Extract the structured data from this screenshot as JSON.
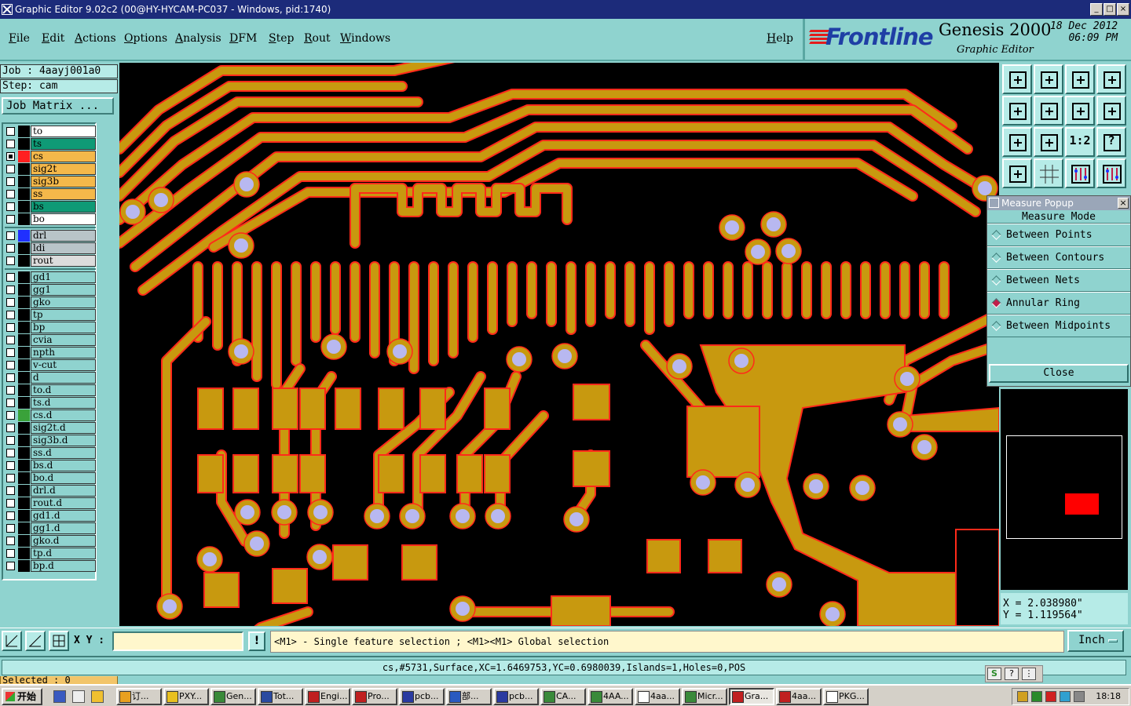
{
  "window": {
    "title": "Graphic Editor 9.02c2 (00@HY-HYCAM-PC037 - Windows, pid:1740)",
    "controls": [
      "_",
      "□",
      "×"
    ]
  },
  "menu": [
    "File",
    "Edit",
    "Actions",
    "Options",
    "Analysis",
    "DFM",
    "Step",
    "Rout",
    "Windows"
  ],
  "help_label": "Help",
  "brand": {
    "logo": "Frontline",
    "product": "Genesis 2000",
    "subtitle": "Graphic Editor",
    "date": "18 Dec 2012",
    "time": "06:09 PM"
  },
  "job": {
    "job_line": "Job : 4aayj001a0",
    "step_line": "Step: cam",
    "matrix_button": "Job Matrix ..."
  },
  "layers": [
    {
      "name": "to",
      "color": "#ffffff",
      "checked": false,
      "swatch": "#000000"
    },
    {
      "name": "ts",
      "color": "#0f9a76",
      "checked": false,
      "swatch": "#000000"
    },
    {
      "name": "cs",
      "color": "#f4b84a",
      "checked": true,
      "swatch": "#ff2020",
      "marker": true
    },
    {
      "name": "sig2t",
      "color": "#f4b84a",
      "checked": false,
      "swatch": "#000000"
    },
    {
      "name": "sig3b",
      "color": "#f4b84a",
      "checked": false,
      "swatch": "#000000"
    },
    {
      "name": "ss",
      "color": "#f4b84a",
      "checked": false,
      "swatch": "#000000"
    },
    {
      "name": "bs",
      "color": "#0f9a76",
      "checked": false,
      "swatch": "#000000"
    },
    {
      "name": "bo",
      "color": "#ffffff",
      "checked": false,
      "swatch": "#000000"
    },
    {
      "name": "drl",
      "color": "#b8c4c8",
      "checked": false,
      "swatch": "#2030ff"
    },
    {
      "name": "ldi",
      "color": "#b8c4c8",
      "checked": false,
      "swatch": "#000000"
    },
    {
      "name": "rout",
      "color": "#dcdcdc",
      "checked": false,
      "swatch": "#000000"
    },
    {
      "name": "gd1",
      "color": "#8fd3cf",
      "checked": false,
      "swatch": "#000000"
    },
    {
      "name": "gg1",
      "color": "#8fd3cf",
      "checked": false,
      "swatch": "#000000"
    },
    {
      "name": "gko",
      "color": "#8fd3cf",
      "checked": false,
      "swatch": "#000000"
    },
    {
      "name": "tp",
      "color": "#8fd3cf",
      "checked": false,
      "swatch": "#000000"
    },
    {
      "name": "bp",
      "color": "#8fd3cf",
      "checked": false,
      "swatch": "#000000"
    },
    {
      "name": "cvia",
      "color": "#8fd3cf",
      "checked": false,
      "swatch": "#000000"
    },
    {
      "name": "npth",
      "color": "#8fd3cf",
      "checked": false,
      "swatch": "#000000"
    },
    {
      "name": "v-cut",
      "color": "#8fd3cf",
      "checked": false,
      "swatch": "#000000"
    },
    {
      "name": "d",
      "color": "#8fd3cf",
      "checked": false,
      "swatch": "#000000"
    },
    {
      "name": "to.d",
      "color": "#8fd3cf",
      "checked": false,
      "swatch": "#000000"
    },
    {
      "name": "ts.d",
      "color": "#8fd3cf",
      "checked": false,
      "swatch": "#000000"
    },
    {
      "name": "cs.d",
      "color": "#8fd3cf",
      "checked": false,
      "swatch": "#3aa23a"
    },
    {
      "name": "sig2t.d",
      "color": "#8fd3cf",
      "checked": false,
      "swatch": "#000000"
    },
    {
      "name": "sig3b.d",
      "color": "#8fd3cf",
      "checked": false,
      "swatch": "#000000"
    },
    {
      "name": "ss.d",
      "color": "#8fd3cf",
      "checked": false,
      "swatch": "#000000"
    },
    {
      "name": "bs.d",
      "color": "#8fd3cf",
      "checked": false,
      "swatch": "#000000"
    },
    {
      "name": "bo.d",
      "color": "#8fd3cf",
      "checked": false,
      "swatch": "#000000"
    },
    {
      "name": "drl.d",
      "color": "#8fd3cf",
      "checked": false,
      "swatch": "#000000"
    },
    {
      "name": "rout.d",
      "color": "#8fd3cf",
      "checked": false,
      "swatch": "#000000"
    },
    {
      "name": "gd1.d",
      "color": "#8fd3cf",
      "checked": false,
      "swatch": "#000000"
    },
    {
      "name": "gg1.d",
      "color": "#8fd3cf",
      "checked": false,
      "swatch": "#000000"
    },
    {
      "name": "gko.d",
      "color": "#8fd3cf",
      "checked": false,
      "swatch": "#000000"
    },
    {
      "name": "tp.d",
      "color": "#8fd3cf",
      "checked": false,
      "swatch": "#000000"
    },
    {
      "name": "bp.d",
      "color": "#8fd3cf",
      "checked": false,
      "swatch": "#000000"
    }
  ],
  "selected": "Selected : 0",
  "tools": [
    "zoom-home-icon",
    "zoom-layer-icon",
    "zoom-home-icon",
    "zoom-window-icon",
    "pan-left-icon",
    "pan-right-icon",
    "redraw-icon",
    "snap-icon",
    "fit-icon",
    "pan-all-icon",
    "scale-1-2-icon",
    "help-query-icon",
    "measure-tool-icon",
    "grid-icon",
    "ruler-red-icon",
    "ruler-red2-icon"
  ],
  "tool_labels": {
    "ratio": "1:2",
    "query": "?"
  },
  "measure": {
    "title": "Measure Popup",
    "mode_label": "Measure Mode",
    "options": [
      {
        "label": "Between Points",
        "selected": false
      },
      {
        "label": "Between Contours",
        "selected": false
      },
      {
        "label": "Between Nets",
        "selected": false
      },
      {
        "label": "Annular Ring",
        "selected": true
      },
      {
        "label": "Between Midpoints",
        "selected": false
      }
    ],
    "close_label": "Close"
  },
  "coords": {
    "x": "X = 2.038980\"",
    "y": "Y = 1.119564\""
  },
  "command": {
    "xy_label": "X Y :",
    "xy_value": "",
    "hint": "<M1> - Single feature selection ; <M1><M1> Global selection",
    "unit": "Inch"
  },
  "status": "cs,#5731,Surface,XC=1.6469753,YC=0.6980039,Islands=1,Holes=0,POS",
  "taskbar": {
    "start": "开始",
    "tasks": [
      {
        "label": "订...",
        "color": "#e8a020"
      },
      {
        "label": "PXY...",
        "color": "#e8c020"
      },
      {
        "label": "Gen...",
        "color": "#3a8a3a"
      },
      {
        "label": "Tot...",
        "color": "#2a4aa0"
      },
      {
        "label": "Engi...",
        "color": "#c02020"
      },
      {
        "label": "Pro...",
        "color": "#c02020"
      },
      {
        "label": "pcb...",
        "color": "#2a3aa0"
      },
      {
        "label": "部...",
        "color": "#2a5ac0"
      },
      {
        "label": "pcb...",
        "color": "#2a3aa0"
      },
      {
        "label": "CA...",
        "color": "#3a8a3a"
      },
      {
        "label": "4AA...",
        "color": "#3a8a3a"
      },
      {
        "label": "4aa...",
        "color": "#ffffff"
      },
      {
        "label": "Micr...",
        "color": "#3a8a3a"
      },
      {
        "label": "Gra...",
        "color": "#c02020",
        "active": true
      },
      {
        "label": "4aa...",
        "color": "#c02020"
      },
      {
        "label": "PKG...",
        "color": "#ffffff"
      }
    ],
    "clock": "18:18"
  }
}
